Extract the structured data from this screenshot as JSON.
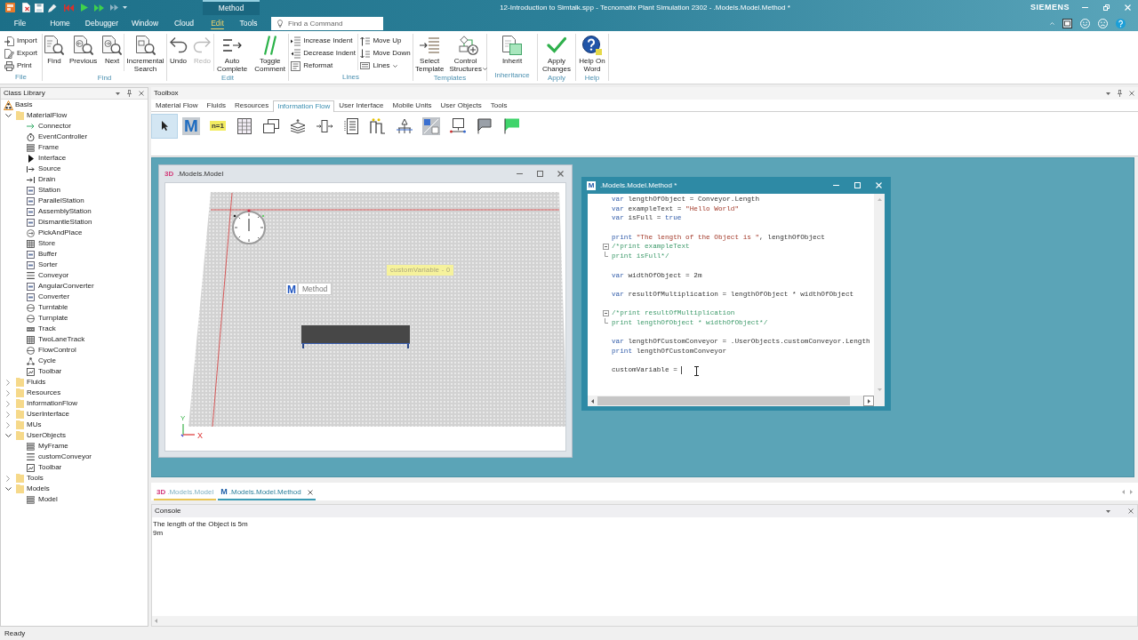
{
  "title_bar": {
    "context_tab": "Method",
    "title": "12-Introduction to Simtalk.spp - Tecnomatix Plant Simulation 2302 - .Models.Model.Method *",
    "brand": "SIEMENS"
  },
  "ribbon_tabs": [
    {
      "label": "File",
      "selected": false
    },
    {
      "label": "Home",
      "selected": false
    },
    {
      "label": "Debugger",
      "selected": false
    },
    {
      "label": "Window",
      "selected": false
    },
    {
      "label": "Cloud",
      "selected": false
    },
    {
      "label": "Edit",
      "selected": true
    },
    {
      "label": "Tools",
      "selected": false
    }
  ],
  "command_search": {
    "placeholder": "Find a Command"
  },
  "ribbon_groups": [
    {
      "label": "File",
      "sections": [
        [
          {
            "label": "Import",
            "kind": "small",
            "disabled": false,
            "dropdown": false
          },
          {
            "label": "Export",
            "kind": "small",
            "disabled": false,
            "dropdown": false
          },
          {
            "label": "Print",
            "kind": "small",
            "disabled": false,
            "dropdown": false
          }
        ]
      ]
    },
    {
      "label": "Find",
      "sections": [
        [
          {
            "label": "Find",
            "kind": "large",
            "disabled": false,
            "dropdown": false
          },
          {
            "label": "Previous",
            "kind": "large",
            "disabled": false,
            "dropdown": false
          },
          {
            "label": "Next",
            "kind": "large",
            "disabled": false,
            "dropdown": false
          }
        ],
        [
          {
            "label": "Incremental Search",
            "kind": "large",
            "disabled": false,
            "dropdown": false
          }
        ]
      ]
    },
    {
      "label": "Edit",
      "sections": [
        [
          {
            "label": "Undo",
            "kind": "large",
            "disabled": false,
            "dropdown": false
          },
          {
            "label": "Redo",
            "kind": "large",
            "disabled": true,
            "dropdown": false
          }
        ],
        [
          {
            "label": "Auto Complete",
            "kind": "large",
            "disabled": false,
            "dropdown": false
          },
          {
            "label": "Toggle Comment",
            "kind": "large",
            "disabled": false,
            "dropdown": false
          }
        ]
      ]
    },
    {
      "label": "Lines",
      "sections": [
        [
          {
            "label": "Increase Indent",
            "kind": "small",
            "disabled": false,
            "dropdown": false
          },
          {
            "label": "Decrease Indent",
            "kind": "small",
            "disabled": false,
            "dropdown": false
          },
          {
            "label": "Reformat",
            "kind": "small",
            "disabled": false,
            "dropdown": false
          }
        ],
        [
          {
            "label": "Move Up",
            "kind": "small",
            "disabled": false,
            "dropdown": false
          },
          {
            "label": "Move Down",
            "kind": "small",
            "disabled": false,
            "dropdown": false
          },
          {
            "label": "Lines",
            "kind": "small",
            "disabled": false,
            "dropdown": true
          }
        ]
      ]
    },
    {
      "label": "Templates",
      "sections": [
        [
          {
            "label": "Select Template",
            "kind": "large",
            "disabled": false,
            "dropdown": false
          },
          {
            "label": "Control Structures",
            "kind": "large",
            "disabled": false,
            "dropdown": true
          }
        ]
      ]
    },
    {
      "label": "Inheritance",
      "sections": [
        [
          {
            "label": "Inherit",
            "kind": "large",
            "disabled": false,
            "dropdown": false
          }
        ]
      ]
    },
    {
      "label": "Apply",
      "sections": [
        [
          {
            "label": "Apply Changes",
            "kind": "large",
            "disabled": false,
            "dropdown": false
          }
        ]
      ]
    },
    {
      "label": "Help",
      "sections": [
        [
          {
            "label": "Help On Word",
            "kind": "large",
            "disabled": false,
            "dropdown": false
          }
        ]
      ]
    }
  ],
  "class_library": {
    "title": "Class Library",
    "tree": [
      {
        "label": "Basis",
        "kind": "library"
      },
      {
        "label": "MaterialFlow",
        "kind": "folder",
        "expanded": true,
        "children": [
          {
            "label": "Connector",
            "kind": "class"
          },
          {
            "label": "EventController",
            "kind": "class"
          },
          {
            "label": "Frame",
            "kind": "class"
          },
          {
            "label": "Interface",
            "kind": "class"
          },
          {
            "label": "Source",
            "kind": "class"
          },
          {
            "label": "Drain",
            "kind": "class"
          },
          {
            "label": "Station",
            "kind": "class"
          },
          {
            "label": "ParallelStation",
            "kind": "class"
          },
          {
            "label": "AssemblyStation",
            "kind": "class"
          },
          {
            "label": "DismantleStation",
            "kind": "class"
          },
          {
            "label": "PickAndPlace",
            "kind": "class"
          },
          {
            "label": "Store",
            "kind": "class"
          },
          {
            "label": "Buffer",
            "kind": "class"
          },
          {
            "label": "Sorter",
            "kind": "class"
          },
          {
            "label": "Conveyor",
            "kind": "class"
          },
          {
            "label": "AngularConverter",
            "kind": "class"
          },
          {
            "label": "Converter",
            "kind": "class"
          },
          {
            "label": "Turntable",
            "kind": "class"
          },
          {
            "label": "Turnplate",
            "kind": "class"
          },
          {
            "label": "Track",
            "kind": "class"
          },
          {
            "label": "TwoLaneTrack",
            "kind": "class"
          },
          {
            "label": "FlowControl",
            "kind": "class"
          },
          {
            "label": "Cycle",
            "kind": "class"
          },
          {
            "label": "Toolbar",
            "kind": "class"
          }
        ]
      },
      {
        "label": "Fluids",
        "kind": "folder",
        "expanded": false
      },
      {
        "label": "Resources",
        "kind": "folder",
        "expanded": false
      },
      {
        "label": "InformationFlow",
        "kind": "folder",
        "expanded": false
      },
      {
        "label": "UserInterface",
        "kind": "folder",
        "expanded": false
      },
      {
        "label": "MUs",
        "kind": "folder",
        "expanded": false
      },
      {
        "label": "UserObjects",
        "kind": "folder",
        "expanded": true,
        "children": [
          {
            "label": "MyFrame",
            "kind": "class"
          },
          {
            "label": "customConveyor",
            "kind": "class"
          },
          {
            "label": "Toolbar",
            "kind": "class"
          }
        ]
      },
      {
        "label": "Tools",
        "kind": "folder",
        "expanded": false
      },
      {
        "label": "Models",
        "kind": "folder",
        "expanded": true,
        "children": [
          {
            "label": "Model",
            "kind": "class"
          }
        ]
      }
    ]
  },
  "toolbox": {
    "title": "Toolbox",
    "tabs": [
      {
        "label": "Material Flow",
        "selected": false
      },
      {
        "label": "Fluids",
        "selected": false
      },
      {
        "label": "Resources",
        "selected": false
      },
      {
        "label": "Information Flow",
        "selected": true
      },
      {
        "label": "User Interface",
        "selected": false
      },
      {
        "label": "Mobile Units",
        "selected": false
      },
      {
        "label": "User Objects",
        "selected": false
      },
      {
        "label": "Tools",
        "selected": false
      }
    ],
    "tools": [
      {
        "selected": true
      },
      {
        "selected": false,
        "glyph": "M"
      },
      {
        "selected": false,
        "glyph": "n=1"
      },
      {
        "selected": false
      },
      {
        "selected": false
      },
      {
        "selected": false
      },
      {
        "selected": false
      },
      {
        "selected": false
      },
      {
        "selected": false
      },
      {
        "selected": false
      },
      {
        "selected": false
      },
      {
        "selected": false
      },
      {
        "selected": false
      },
      {
        "selected": false
      }
    ]
  },
  "model_window": {
    "badge": "3D",
    "title": ".Models.Model",
    "variable_label": "customVariable - 0",
    "method_glyph": "M",
    "method_label": "Method",
    "axis_y": "Y",
    "axis_x": "X"
  },
  "method_window": {
    "glyph": "M",
    "title": ".Models.Model.Method *",
    "blocks": [
      [
        {
          "fold_start": false,
          "fold_end": false,
          "segments": [
            {
              "kind": "keyword",
              "text": "var"
            },
            {
              "kind": "plain",
              "text": " lengthOfObject = Conveyor.Length"
            }
          ]
        },
        {
          "fold_start": false,
          "fold_end": false,
          "segments": [
            {
              "kind": "keyword",
              "text": "var"
            },
            {
              "kind": "plain",
              "text": " exampleText = "
            },
            {
              "kind": "string",
              "text": "\"Hello World\""
            }
          ]
        },
        {
          "fold_start": false,
          "fold_end": false,
          "segments": [
            {
              "kind": "keyword",
              "text": "var"
            },
            {
              "kind": "plain",
              "text": " isFull = "
            },
            {
              "kind": "keyword",
              "text": "true"
            }
          ]
        }
      ],
      [
        {
          "fold_start": false,
          "fold_end": false,
          "segments": [
            {
              "kind": "keyword",
              "text": "print "
            },
            {
              "kind": "string",
              "text": "\"The length of the Object is \""
            },
            {
              "kind": "plain",
              "text": ", lengthOfObject"
            }
          ]
        },
        {
          "fold_start": true,
          "fold_end": false,
          "segments": [
            {
              "kind": "comment",
              "text": "/*print exampleText"
            }
          ]
        },
        {
          "fold_start": false,
          "fold_end": true,
          "segments": [
            {
              "kind": "comment",
              "text": "print isFull*/"
            }
          ]
        }
      ],
      [
        {
          "fold_start": false,
          "fold_end": false,
          "segments": [
            {
              "kind": "keyword",
              "text": "var"
            },
            {
              "kind": "plain",
              "text": " widthOfObject = 2m"
            }
          ]
        }
      ],
      [
        {
          "fold_start": false,
          "fold_end": false,
          "segments": [
            {
              "kind": "keyword",
              "text": "var"
            },
            {
              "kind": "plain",
              "text": " resultOfMultiplication = lengthOfObject * widthOfObject"
            }
          ]
        }
      ],
      [
        {
          "fold_start": true,
          "fold_end": false,
          "segments": [
            {
              "kind": "comment",
              "text": "/*print resultOfMultiplication"
            }
          ]
        },
        {
          "fold_start": false,
          "fold_end": true,
          "segments": [
            {
              "kind": "comment",
              "text": "print lengthOfObject * widthOfObject*/"
            }
          ]
        }
      ],
      [
        {
          "fold_start": false,
          "fold_end": false,
          "segments": [
            {
              "kind": "keyword",
              "text": "var"
            },
            {
              "kind": "plain",
              "text": " lengthOfCustomConveyor = .UserObjects.customConveyor.Length"
            }
          ]
        },
        {
          "fold_start": false,
          "fold_end": false,
          "segments": [
            {
              "kind": "keyword",
              "text": "print"
            },
            {
              "kind": "plain",
              "text": " lengthOfCustomConveyor"
            }
          ]
        }
      ],
      [
        {
          "fold_start": false,
          "fold_end": false,
          "segments": [
            {
              "kind": "plain",
              "text": "customVariable = "
            },
            {
              "kind": "caret"
            }
          ]
        }
      ]
    ]
  },
  "document_tabs": [
    {
      "kind": "model",
      "glyph": "3D",
      "label": ".Models.Model",
      "selected": false
    },
    {
      "kind": "method",
      "glyph": "M",
      "label": ".Models.Model.Method",
      "selected": true
    }
  ],
  "console": {
    "title": "Console",
    "lines": [
      "The length of the Object is 5m",
      "9m"
    ]
  },
  "status_bar": {
    "text": "Ready"
  }
}
